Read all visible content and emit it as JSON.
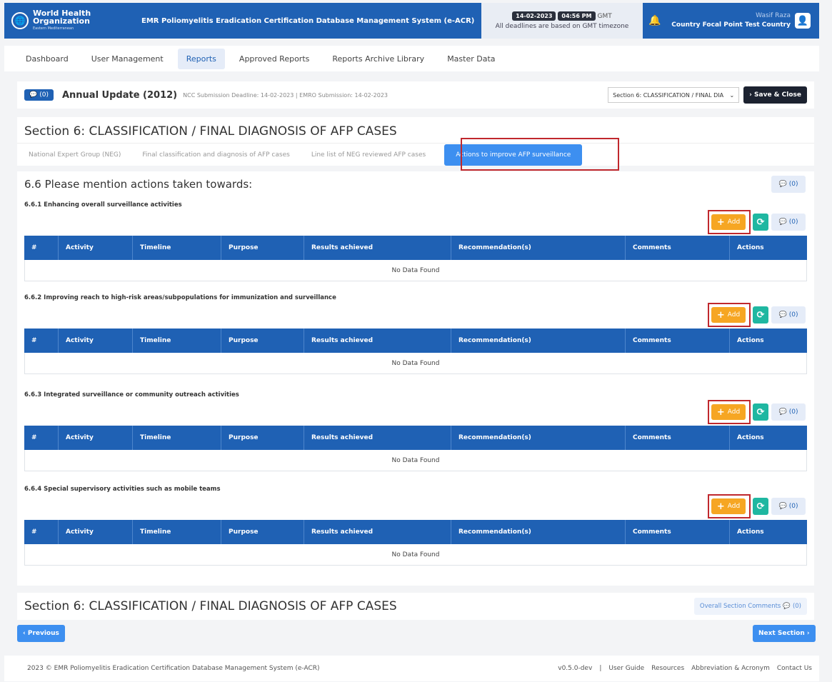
{
  "header": {
    "org_line1": "World Health",
    "org_line2": "Organization",
    "org_region": "Eastern Mediterranean",
    "app_title": "EMR Poliomyelitis Eradication Certification Database Management System (e-ACR)",
    "date": "14-02-2023",
    "time": "04:56 PM",
    "tz": "GMT",
    "deadline_note": "All deadlines are based on GMT timezone",
    "user_name": "Wasif Raza",
    "user_role": "Country Focal Point Test Country"
  },
  "nav": {
    "items": [
      "Dashboard",
      "User Management",
      "Reports",
      "Approved Reports",
      "Reports Archive Library",
      "Master Data"
    ],
    "active": "Reports"
  },
  "annual": {
    "chat_count": "(0)",
    "title": "Annual Update (2012)",
    "deadlines": "NCC Submission Deadline: 14-02-2023 | EMRO Submission: 14-02-2023",
    "section_select": "Section 6: CLASSIFICATION / FINAL DIA",
    "save_close": "Save & Close"
  },
  "section": {
    "title": "Section 6: CLASSIFICATION / FINAL DIAGNOSIS OF AFP CASES",
    "tabs": [
      "National Expert Group (NEG)",
      "Final classification and diagnosis of AFP cases",
      "Line list of NEG reviewed AFP cases",
      "Actions to improve AFP surveillance"
    ]
  },
  "main": {
    "title": "6.6 Please mention actions taken towards:",
    "chat_count": "(0)",
    "add_label": "Add",
    "no_data": "No Data Found",
    "columns": [
      "#",
      "Activity",
      "Timeline",
      "Purpose",
      "Results achieved",
      "Recommendation(s)",
      "Comments",
      "Actions"
    ],
    "subsections": [
      {
        "title": "6.6.1 Enhancing overall surveillance activities",
        "chat": "(0)"
      },
      {
        "title": "6.6.2 Improving reach to high-risk areas/subpopulations for immunization and surveillance",
        "chat": "(0)"
      },
      {
        "title": "6.6.3 Integrated surveillance or community outreach activities",
        "chat": "(0)"
      },
      {
        "title": "6.6.4 Special supervisory activities such as mobile teams",
        "chat": "(0)"
      }
    ]
  },
  "footer_section": {
    "title": "Section 6: CLASSIFICATION / FINAL DIAGNOSIS OF AFP CASES",
    "overall_comments": "Overall Section Comments",
    "overall_count": "(0)",
    "prev": "Previous",
    "next": "Next Section"
  },
  "footer": {
    "copyright": "2023 © EMR Poliomyelitis Eradication Certification Database Management System (e-ACR)",
    "version": "v0.5.0-dev",
    "links": [
      "User Guide",
      "Resources",
      "Abbreviation & Acronym",
      "Contact Us"
    ]
  }
}
